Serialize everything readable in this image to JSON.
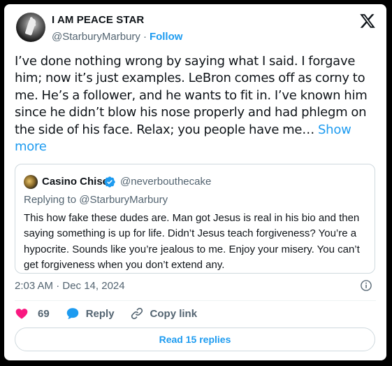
{
  "author": {
    "display_name": "I AM PEACE STAR",
    "handle": "@StarburyMarbury",
    "separator": "·",
    "follow_label": "Follow"
  },
  "tweet": {
    "text": "I’ve done nothing wrong by saying what I said. I forgave him; now it’s just examples. LeBron comes off as corny to me. He’s a follower, and he wants to fit in. I’ve known him since he didn’t blow his nose properly and had phlegm on the side of his face. Relax; you people have me…",
    "show_more_label": "Show more",
    "timestamp": "2:03 AM · Dec 14, 2024"
  },
  "quoted": {
    "display_name": "Casino Chise",
    "handle": "@neverbouthecake",
    "replying_to": "Replying to @StarburyMarbury",
    "text": "This how fake these dudes are. Man got Jesus is real in his bio and then saying something is up for life. Didn’t Jesus teach forgiveness? You’re a hypocrite. Sounds like you’re jealous to me. Enjoy your misery. You can’t get forgiveness when you don’t extend any."
  },
  "actions": {
    "likes_count": "69",
    "reply_label": "Reply",
    "copy_link_label": "Copy link",
    "read_replies_label": "Read 15 replies"
  },
  "icons": {
    "logo": "x-logo-icon",
    "like": "heart-icon",
    "reply": "speech-bubble-icon",
    "copy": "link-icon",
    "info": "info-icon",
    "verified": "verified-badge-icon"
  },
  "colors": {
    "accent": "#1d9bf0",
    "heart": "#f91880",
    "text": "#0f1419",
    "muted": "#536471",
    "border": "#cfd9de"
  }
}
